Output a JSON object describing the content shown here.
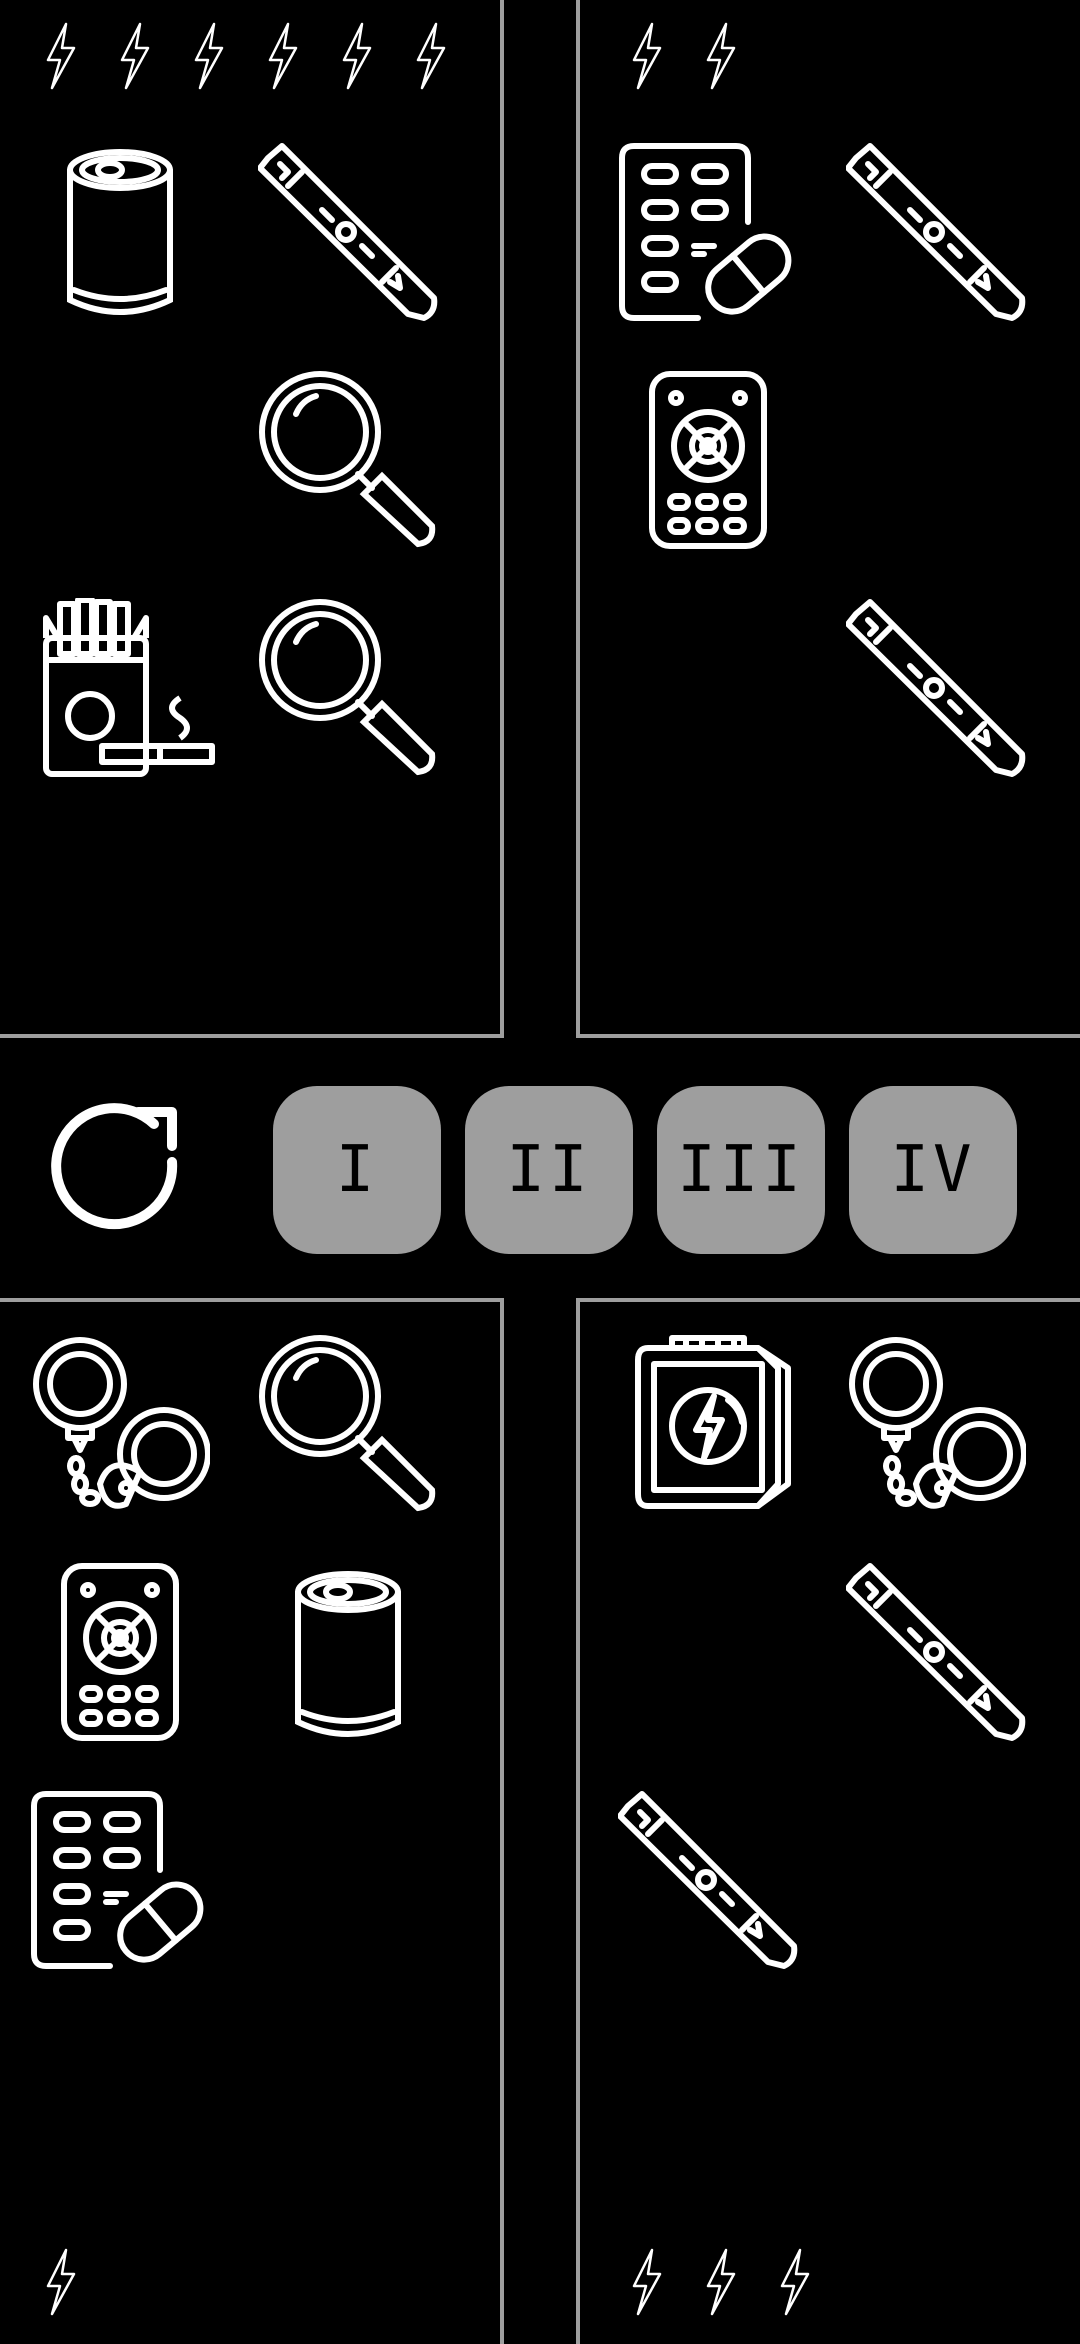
{
  "controls": {
    "reset_icon": "refresh-icon",
    "buttons": [
      "I",
      "II",
      "III",
      "IV"
    ]
  },
  "panels": [
    {
      "id": "I",
      "charges": 6,
      "items": [
        "soda-can",
        "injector-pen",
        "magnifier",
        "magnifier",
        "cigarettes"
      ]
    },
    {
      "id": "II",
      "charges": 2,
      "items": [
        "pill-pack",
        "injector-pen",
        "remote",
        "injector-pen"
      ]
    },
    {
      "id": "III",
      "charges": 1,
      "items": [
        "handcuffs",
        "magnifier",
        "remote",
        "soda-can",
        "pill-pack"
      ]
    },
    {
      "id": "IV",
      "charges": 3,
      "items": [
        "battery-pack",
        "handcuffs",
        "injector-pen",
        "injector-pen"
      ]
    }
  ],
  "colors": {
    "background": "#000000",
    "line": "#ffffff",
    "border": "#9e9e9e",
    "button": "#9e9e9e"
  }
}
